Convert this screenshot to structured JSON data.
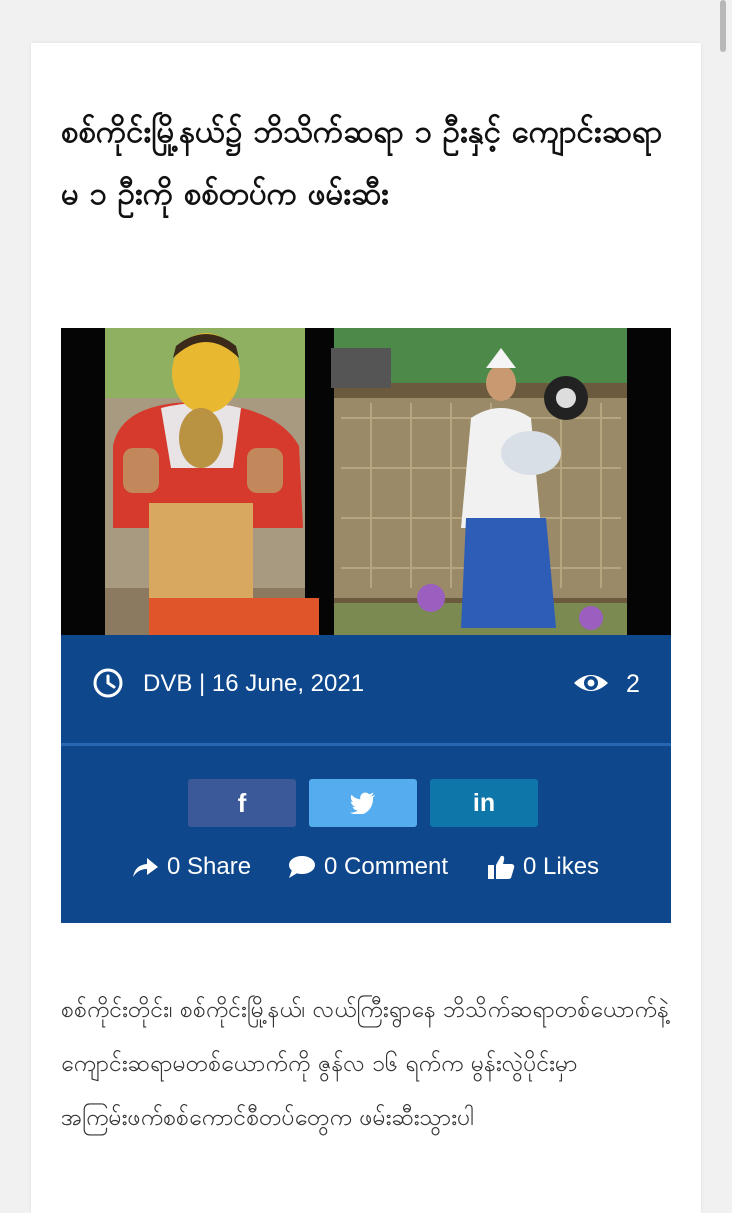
{
  "article": {
    "title": "စစ်ကိုင်းမြို့နယ်၌ ဘိသိက်ဆရာ ၁ ဦးနှင့် ကျောင်းဆရာမ ၁ ဦးကို စစ်တပ်က ဖမ်းဆီး",
    "meta": {
      "author_date": "DVB | 16 June, 2021",
      "views": "2"
    },
    "social": {
      "facebook_label": "f",
      "linkedin_label": "in",
      "share": "0 Share",
      "comment": "0 Comment",
      "likes": "0 Likes"
    },
    "body": "စစ်ကိုင်းတိုင်း၊ စစ်ကိုင်းမြို့နယ်၊ လယ်ကြီးရွာနေ ဘိသိက်ဆရာတစ်ယောက်နဲ့ ကျောင်းဆရာမတစ်ယောက်ကို ဇွန်လ ၁၆ ရက်က မွန်းလွဲပိုင်းမှာ အကြမ်းဖက်စစ်ကောင်စီတပ်တွေက ဖမ်းဆီးသွားပါ"
  },
  "colors": {
    "meta_bg": "#0e478b",
    "facebook": "#3b5998",
    "twitter": "#55acee",
    "linkedin": "#0e76a8"
  },
  "icons": [
    "clock-icon",
    "eye-icon",
    "twitter-bird-icon",
    "share-arrow-icon",
    "comment-bubble-icon",
    "thumbs-up-icon"
  ]
}
